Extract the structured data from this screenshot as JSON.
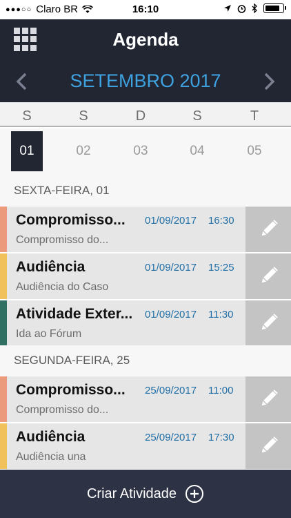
{
  "status_bar": {
    "signal": "●●●○○",
    "carrier": "Claro BR",
    "time": "16:10"
  },
  "header": {
    "title": "Agenda",
    "month": "SETEMBRO 2017"
  },
  "weekdays": [
    "S",
    "S",
    "D",
    "S",
    "T"
  ],
  "days": [
    "01",
    "02",
    "03",
    "04",
    "05"
  ],
  "selected_day": "01",
  "sections": [
    {
      "label": "SEXTA-FEIRA, 01",
      "items": [
        {
          "title": "Compromisso...",
          "date": "01/09/2017",
          "time": "16:30",
          "subtitle": "Compromisso do...",
          "color": "#ec9a7c"
        },
        {
          "title": "Audiência",
          "date": "01/09/2017",
          "time": "15:25",
          "subtitle": "Audiência do Caso",
          "color": "#f1c15c"
        },
        {
          "title": "Atividade Exter...",
          "date": "01/09/2017",
          "time": "11:30",
          "subtitle": "Ida ao Fórum",
          "color": "#2f7063"
        }
      ]
    },
    {
      "label": "SEGUNDA-FEIRA, 25",
      "items": [
        {
          "title": "Compromisso...",
          "date": "25/09/2017",
          "time": "11:00",
          "subtitle": "Compromisso do...",
          "color": "#ec9a7c"
        },
        {
          "title": "Audiência",
          "date": "25/09/2017",
          "time": "17:30",
          "subtitle": "Audiência una",
          "color": "#f1c15c"
        }
      ]
    }
  ],
  "footer": {
    "create_label": "Criar Atividade"
  },
  "colors": {
    "header_bg": "#222633",
    "accent": "#3ea2e0",
    "footer_bg": "#2d3245"
  },
  "icons": [
    "grid-menu-icon",
    "chevron-left-icon",
    "chevron-right-icon",
    "pencil-icon",
    "plus-circle-icon",
    "wifi-icon",
    "location-icon",
    "alarm-icon",
    "bluetooth-icon",
    "battery-icon"
  ]
}
